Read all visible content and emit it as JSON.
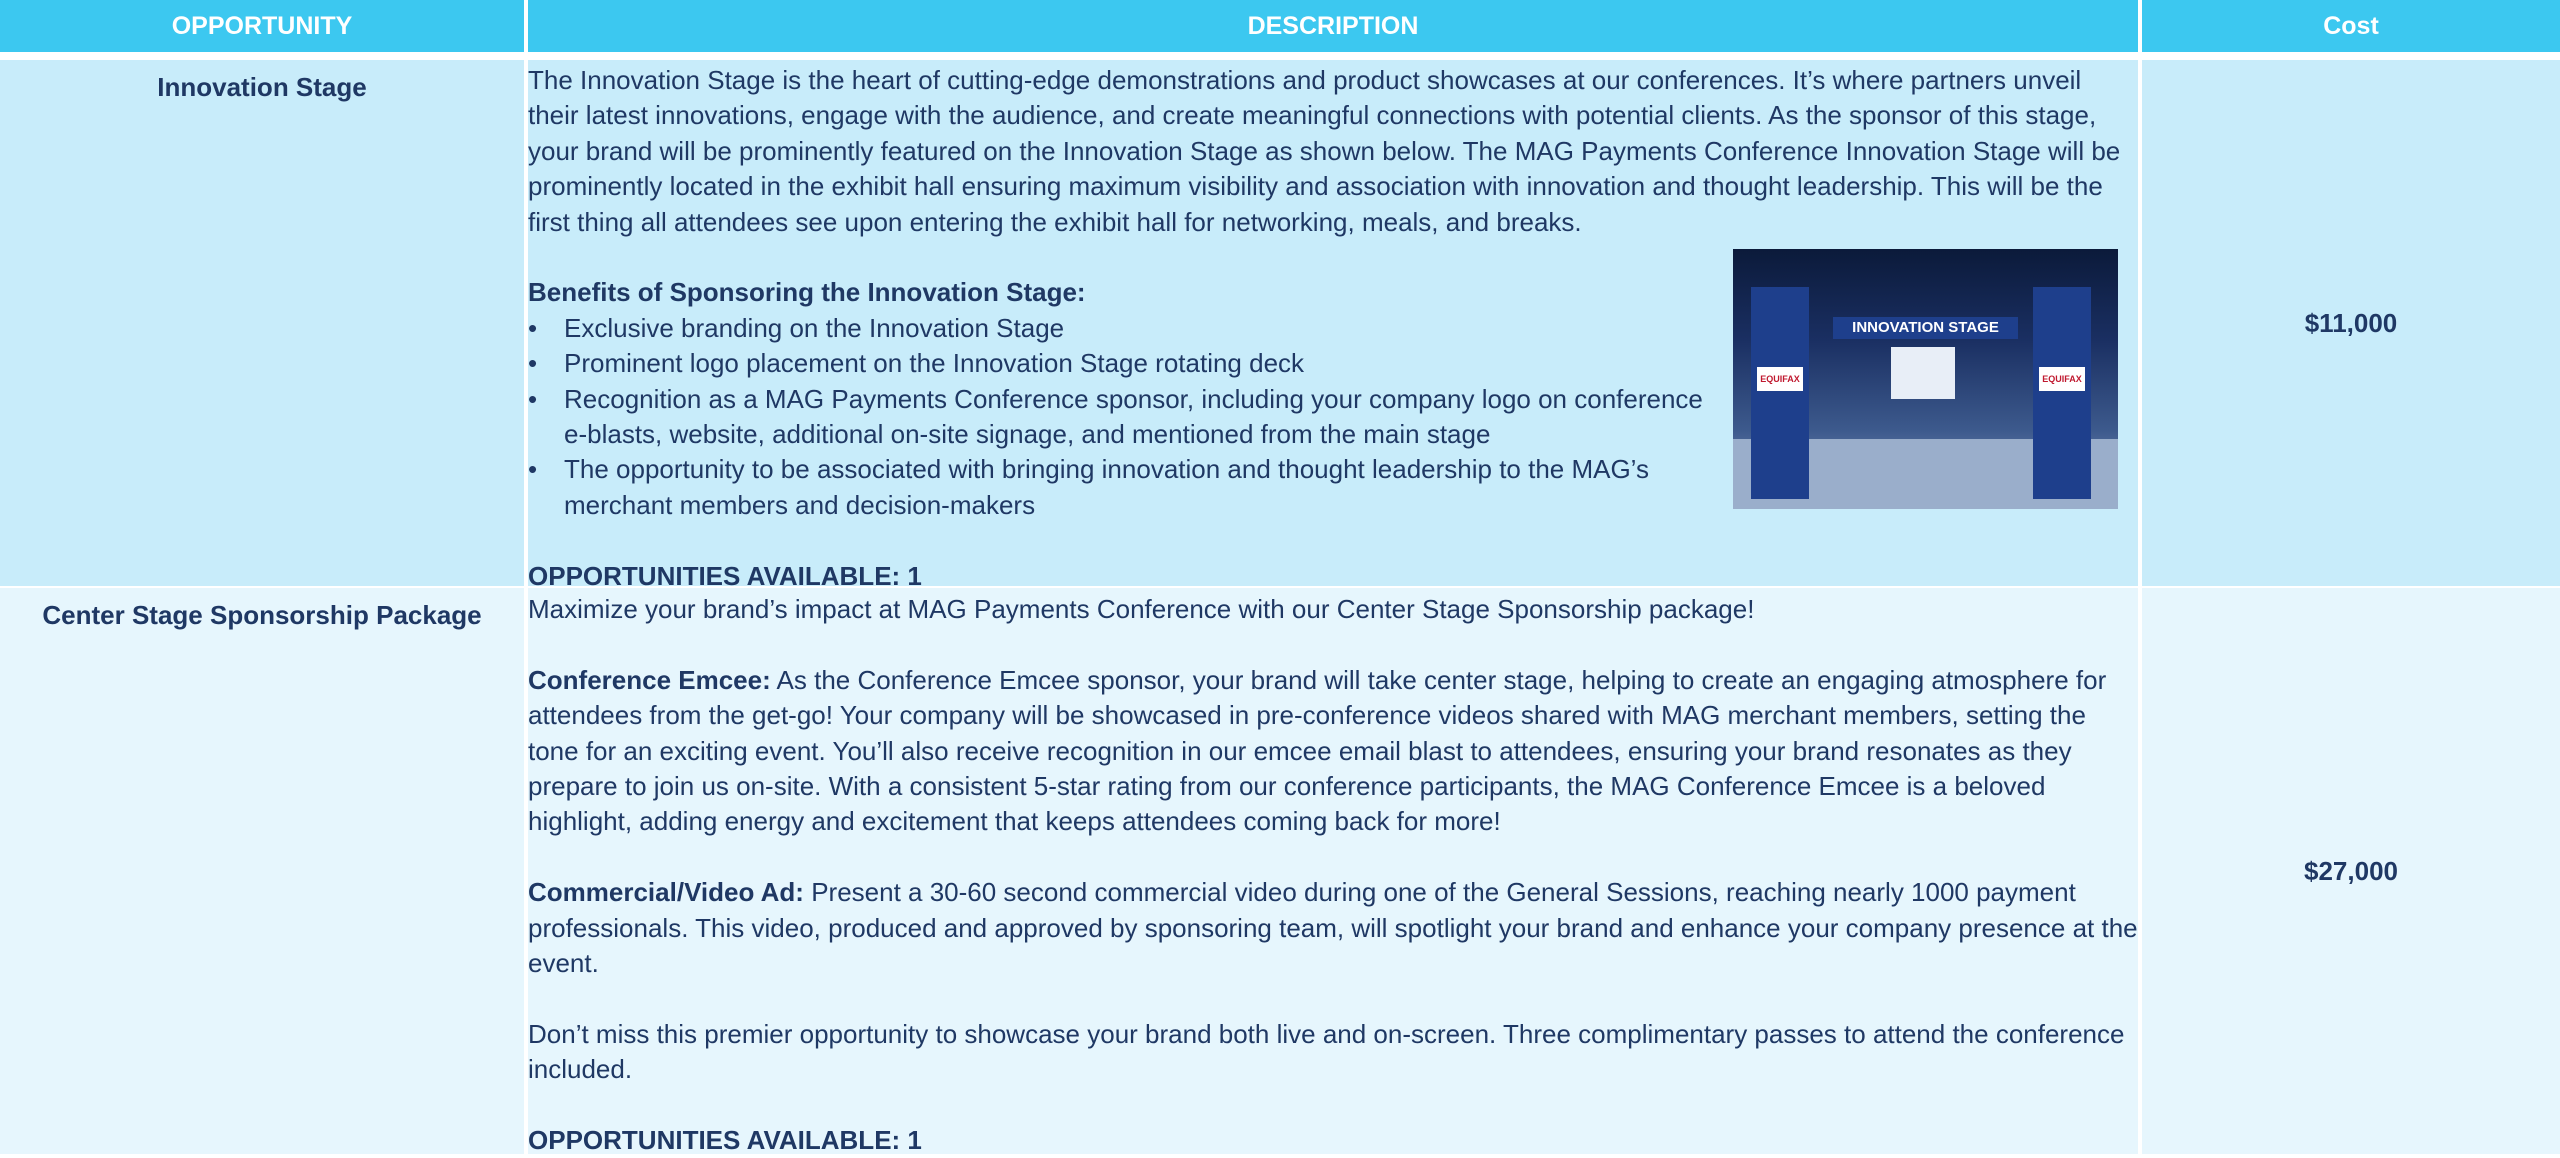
{
  "header": {
    "col_opportunity": "OPPORTUNITY",
    "col_description": "DESCRIPTION",
    "col_cost": "Cost"
  },
  "rows": [
    {
      "opportunity": "Innovation Stage",
      "intro": "The Innovation Stage is the heart of cutting-edge demonstrations and product showcases at our conferences. It’s where partners unveil their latest innovations, engage with the audience, and create meaningful connections with potential clients. As the sponsor of this stage, your brand will be prominently featured on the Innovation Stage as shown below. The MAG Payments Conference Innovation Stage will be prominently located in the exhibit hall ensuring maximum visibility and association with innovation and thought leadership. This will be the first thing all attendees see upon entering the exhibit hall for networking, meals, and breaks.",
      "benefits_title": "Benefits of Sponsoring the Innovation Stage:",
      "benefits": [
        "Exclusive branding on the Innovation Stage",
        "Prominent logo placement on the Innovation Stage rotating deck",
        "Recognition as a MAG Payments Conference sponsor, including your company logo on conference e-blasts, website, additional on-site signage, and mentioned from the main stage",
        "The opportunity to be associated with bringing innovation and thought leadership to the MAG’s merchant members and decision-makers"
      ],
      "image_banner": "INNOVATION STAGE",
      "image_logo": "EQUIFAX",
      "availability": "OPPORTUNITIES AVAILABLE: 1",
      "cost": "$11,000"
    },
    {
      "opportunity": "Center Stage Sponsorship Package",
      "intro": "Maximize your brand’s impact at MAG Payments Conference with our Center Stage Sponsorship package!",
      "emcee_label": "Conference Emcee:",
      "emcee_text": " As the Conference Emcee sponsor, your brand will take center stage, helping to create an engaging atmosphere for attendees from the get-go! Your company will be showcased in pre-conference videos shared with MAG merchant members, setting the tone for an exciting event. You’ll also receive recognition in our emcee email blast to attendees, ensuring your brand resonates as they prepare to join us on-site. With a consistent 5-star rating from our conference participants, the MAG Conference Emcee is a beloved highlight, adding energy and excitement that keeps attendees coming back for more!",
      "video_label": "Commercial/Video Ad:",
      "video_text": " Present a 30-60 second commercial video during one of the General Sessions, reaching nearly 1000 payment professionals. This video, produced and approved by sponsoring team, will spotlight your brand and enhance your company presence at the event.",
      "closing": "Don’t miss this premier opportunity to showcase your brand both live and on-screen. Three complimentary passes to attend the conference included.",
      "availability": "OPPORTUNITIES AVAILABLE: 1",
      "cost": "$27,000"
    }
  ]
}
